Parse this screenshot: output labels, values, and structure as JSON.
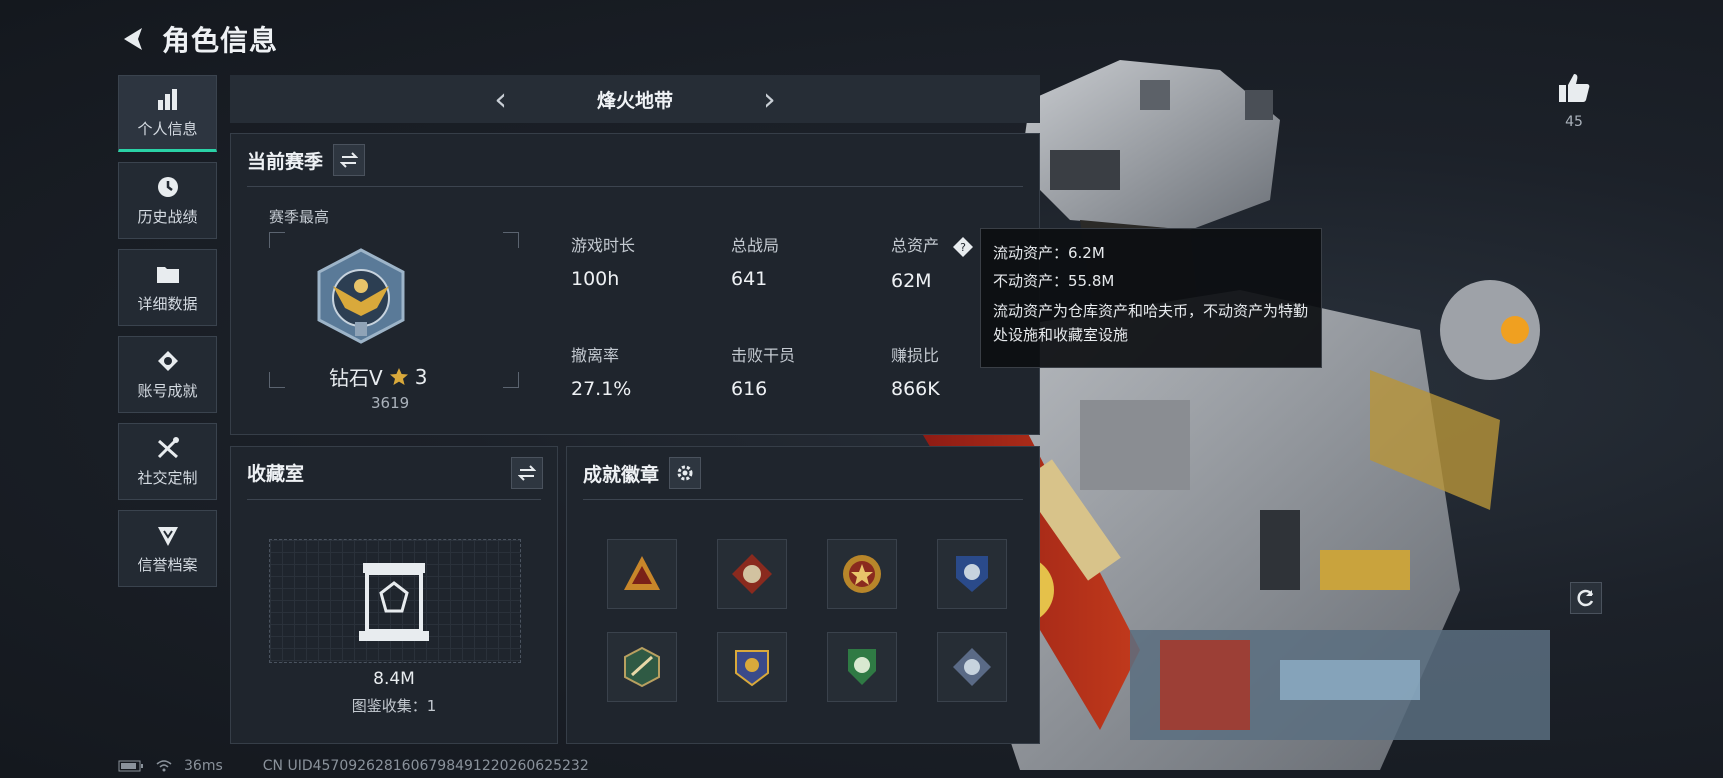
{
  "header": {
    "title": "角色信息"
  },
  "sidebar": {
    "items": [
      {
        "label": "个人信息",
        "icon": "bar-chart-icon",
        "active": true
      },
      {
        "label": "历史战绩",
        "icon": "clock-icon"
      },
      {
        "label": "详细数据",
        "icon": "folder-icon"
      },
      {
        "label": "账号成就",
        "icon": "achievement-icon"
      },
      {
        "label": "社交定制",
        "icon": "tools-icon"
      },
      {
        "label": "信誉档案",
        "icon": "shield-icon"
      }
    ]
  },
  "mode": {
    "title": "烽火地带",
    "prev": "‹",
    "next": "›"
  },
  "season": {
    "title": "当前赛季",
    "rank_label": "赛季最高",
    "rank_name": "钻石Ⅴ",
    "rank_stars": "3",
    "rank_score": "3619",
    "stats": [
      {
        "label": "游戏时长",
        "value": "100h"
      },
      {
        "label": "总战局",
        "value": "641"
      },
      {
        "label": "总资产",
        "value": "62M"
      },
      {
        "label": "撤离率",
        "value": "27.1%"
      },
      {
        "label": "击败干员",
        "value": "616"
      },
      {
        "label": "赚损比",
        "value": "866K"
      }
    ]
  },
  "tooltip": {
    "liquid": "流动资产：6.2M",
    "fixed": "不动资产：55.8M",
    "desc": "流动资产为仓库资产和哈夫币，不动资产为特勤处设施和收藏室设施"
  },
  "collection": {
    "title": "收藏室",
    "value": "8.4M",
    "count": "图鉴收集：1"
  },
  "achievements": {
    "title": "成就徽章"
  },
  "likes": {
    "count": "45"
  },
  "footer": {
    "ping": "36ms",
    "uid": "CN UID4570926281606798491220260625232"
  },
  "colors": {
    "accent": "#2ad1a6",
    "panel": "#1f252d",
    "gold": "#d9a93b"
  }
}
